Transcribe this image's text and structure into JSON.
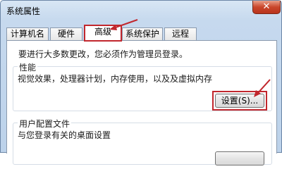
{
  "window": {
    "title": "系统属性",
    "close_label": "✕"
  },
  "tabs": [
    {
      "label": "计算机名",
      "active": false
    },
    {
      "label": "硬件",
      "active": false
    },
    {
      "label": "高级",
      "active": true
    },
    {
      "label": "系统保护",
      "active": false
    },
    {
      "label": "远程",
      "active": false
    }
  ],
  "panel": {
    "intro": "要进行大多数更改，您必须作为管理员登录。",
    "performance": {
      "title": "性能",
      "description": "视觉效果，处理器计划，内存使用，以及及虚拟内存",
      "settings_label": "设置(S)..."
    },
    "user_profiles": {
      "title": "用户配置文件",
      "description": "与您登录有关的桌面设置"
    }
  },
  "colors": {
    "annotation": "#c1272d",
    "title_gradient_top": "#d8e6f4",
    "close_button": "#c9462c"
  },
  "icons": {
    "close": "close-icon",
    "arrow": "annotation-arrow"
  }
}
